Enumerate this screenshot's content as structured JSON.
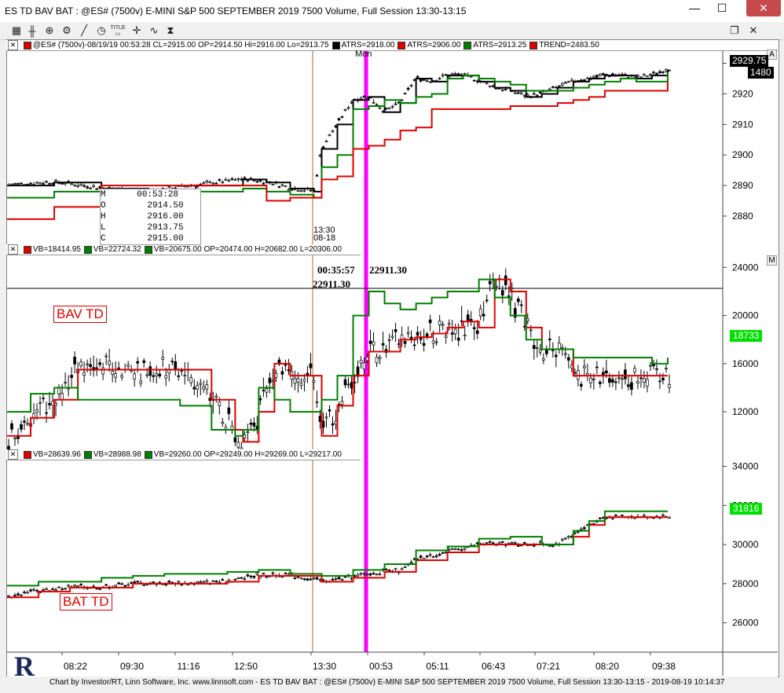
{
  "window": {
    "title": "ES TD BAV BAT : @ES# (7500v) E-MINI S&P 500 SEPTEMBER 2019 7500 Volume, Full Session 13:30-13:15",
    "close_label": "✕"
  },
  "toolbar": {
    "icons": [
      "chart-icon",
      "bar-style-icon",
      "zoom-icon",
      "settings-icon",
      "draw-line-icon",
      "clock-icon",
      "title-icon",
      "crosshair-icon",
      "cycle-icon",
      "hourglass-icon"
    ],
    "title_label": "TITLE"
  },
  "panel_top": {
    "header": "@ES# (7500v)-08/19/19 00:53:28 CL=2915.00 OP=2914.50 Hi=2916.00 Lo=2913.75",
    "legend": [
      {
        "label": "ATRS=2918.00",
        "color": "#000000"
      },
      {
        "label": "ATRS=2906.00",
        "color": "#e00000"
      },
      {
        "label": "ATRS=2913.25",
        "color": "#008000"
      },
      {
        "label": "TREND=2483.50",
        "color": "#e00000"
      }
    ],
    "day_label": "Mon",
    "session_time": "13:30",
    "session_date": "08-18",
    "price_badge": "2929.75",
    "volume_badge": "1480",
    "corner_label": "A",
    "ohlc": {
      "time": [
        "M",
        "00:53:28"
      ],
      "open": [
        "O",
        "2914.50"
      ],
      "high": [
        "H",
        "2916.00"
      ],
      "low": [
        "L",
        "2913.75"
      ],
      "close": [
        "C",
        "2915.00"
      ]
    }
  },
  "panel_mid": {
    "header_legend": [
      {
        "label": "VB=18414.95",
        "color": "#e00000"
      },
      {
        "label": "VB=22724.32",
        "color": "#008000"
      },
      {
        "label": "VB=20675.00 OP=20474.00 H=20682.00 L=20306.00",
        "color": "#008000"
      }
    ],
    "study_label": "BAV TD",
    "crosshair_time": "00:35:57",
    "crosshair_value": "22911.30",
    "crosshair_value_left": "22911.30",
    "value_badge": "18733",
    "corner_label": "M"
  },
  "panel_bot": {
    "header_legend": [
      {
        "label": "VB=28639.96",
        "color": "#e00000"
      },
      {
        "label": "VB=28988.98",
        "color": "#008000"
      },
      {
        "label": "VB=29260.00 OP=29249.00 H=29269.00 L=29217.00",
        "color": "#008000"
      }
    ],
    "study_label": "BAT TD",
    "value_badge": "31816"
  },
  "footer": {
    "text": "Chart by Investor/RT, Linn Software, Inc. www.linnsoft.com - ES TD BAV BAT : @ES# (7500v) E-MINI S&P 500 SEPTEMBER 2019 7500 Volume, Full Session 13:30-13:15 - 2019-08-19 10:14:37",
    "logo_letter": "R"
  },
  "colors": {
    "red": "#e00000",
    "green": "#008000",
    "magenta": "#ff00ff",
    "session_line": "#c06030",
    "badge_green": "#00e000"
  },
  "chart_data": [
    {
      "type": "line",
      "name": "price",
      "ylim": [
        2871,
        2934
      ],
      "yticks": [
        "2930",
        "2920",
        "2910",
        "2900",
        "2890",
        "2880"
      ],
      "series": [
        {
          "name": "ATRS=2918.00",
          "color": "#000000",
          "x": [
            0,
            60,
            120,
            180,
            240,
            300,
            330,
            360,
            390,
            400,
            420,
            440,
            460,
            480,
            500,
            520,
            540,
            560,
            580,
            600,
            620,
            640,
            660,
            680,
            700,
            720,
            740,
            760,
            780,
            800,
            820,
            840
          ],
          "values": [
            2890,
            2891,
            2889,
            2888,
            2890,
            2892,
            2891,
            2889,
            2888,
            2902,
            2910,
            2918,
            2919,
            2914,
            2917,
            2925,
            2924,
            2926,
            2926,
            2924,
            2922,
            2921,
            2919,
            2920,
            2922,
            2924,
            2925,
            2926,
            2926,
            2925,
            2926,
            2928
          ]
        },
        {
          "name": "ATRS=2913.25",
          "color": "#008000",
          "x": [
            0,
            60,
            120,
            180,
            240,
            300,
            330,
            360,
            390,
            400,
            420,
            440,
            460,
            480,
            500,
            520,
            540,
            560,
            580,
            600,
            620,
            640,
            660,
            680,
            700,
            720,
            740,
            760,
            780,
            800,
            820,
            840
          ],
          "values": [
            2886,
            2888,
            2887,
            2886,
            2888,
            2889,
            2888,
            2887,
            2886,
            2896,
            2900,
            2915,
            2916,
            2918,
            2917,
            2919,
            2920,
            2925,
            2926,
            2925,
            2924,
            2923,
            2921,
            2921,
            2921,
            2922,
            2923,
            2924,
            2925,
            2924,
            2924,
            2927
          ]
        },
        {
          "name": "ATRS=2906.00",
          "color": "#e00000",
          "x": [
            0,
            60,
            120,
            180,
            240,
            300,
            330,
            360,
            390,
            400,
            420,
            440,
            460,
            480,
            500,
            520,
            540,
            560,
            580,
            600,
            620,
            640,
            660,
            680,
            700,
            720,
            740,
            760,
            780,
            800,
            820,
            840
          ],
          "values": [
            2879,
            2883,
            2890,
            2890,
            2890,
            2890,
            2885,
            2886,
            2886,
            2892,
            2893,
            2902,
            2903,
            2905,
            2908,
            2909,
            2915,
            2915,
            2915,
            2915,
            2915,
            2916,
            2916,
            2916,
            2917,
            2918,
            2919,
            2921,
            2921,
            2921,
            2921,
            2924
          ]
        }
      ]
    },
    {
      "type": "line",
      "name": "BAV TD",
      "ylim": [
        9000,
        25000
      ],
      "yticks": [
        "24000",
        "20000",
        "16000",
        "12000"
      ],
      "series": [
        {
          "name": "VB=18414.95",
          "color": "#e00000",
          "x": [
            0,
            30,
            60,
            90,
            120,
            180,
            220,
            260,
            290,
            300,
            320,
            340,
            360,
            390,
            400,
            420,
            440,
            460,
            480,
            500,
            520,
            540,
            560,
            580,
            600,
            620,
            640,
            660,
            680,
            700,
            720,
            740,
            760,
            780,
            800,
            820,
            840
          ],
          "values": [
            10000,
            11500,
            13000,
            15500,
            15500,
            15500,
            15500,
            13000,
            10500,
            9500,
            12000,
            16000,
            15000,
            15000,
            10000,
            12500,
            15000,
            17000,
            17000,
            18000,
            18200,
            18500,
            19000,
            19500,
            19000,
            23000,
            22000,
            19000,
            17200,
            17200,
            15000,
            15000,
            15000,
            15000,
            15000,
            15000,
            15000
          ]
        },
        {
          "name": "VB=22724.32",
          "color": "#008000",
          "x": [
            0,
            30,
            60,
            90,
            120,
            180,
            220,
            260,
            290,
            300,
            320,
            340,
            360,
            390,
            400,
            420,
            440,
            460,
            480,
            500,
            520,
            540,
            560,
            580,
            600,
            620,
            640,
            660,
            680,
            700,
            720,
            740,
            760,
            780,
            800,
            820,
            840
          ],
          "values": [
            12000,
            13500,
            14000,
            13000,
            13000,
            13000,
            12500,
            10500,
            10000,
            10500,
            14000,
            13000,
            12000,
            12000,
            13000,
            15000,
            20000,
            22000,
            21000,
            20500,
            21000,
            21500,
            22000,
            22000,
            23000,
            21500,
            20000,
            18000,
            17200,
            17200,
            16500,
            16500,
            16500,
            16500,
            16500,
            16000,
            16500
          ]
        }
      ]
    },
    {
      "type": "line",
      "name": "BAT TD",
      "ylim": [
        24500,
        34300
      ],
      "yticks": [
        "34000",
        "32000",
        "30000",
        "28000",
        "26000"
      ],
      "series": [
        {
          "name": "VB=28639.96",
          "color": "#e00000",
          "x": [
            0,
            40,
            80,
            120,
            160,
            200,
            240,
            280,
            320,
            360,
            400,
            440,
            480,
            500,
            520,
            560,
            600,
            640,
            680,
            700,
            720,
            740,
            760,
            800,
            840
          ],
          "values": [
            27300,
            27600,
            27800,
            27800,
            28000,
            28000,
            28000,
            28100,
            28400,
            28400,
            28100,
            28300,
            28600,
            28600,
            29200,
            29600,
            30000,
            30000,
            30000,
            30000,
            30400,
            31000,
            31400,
            31400,
            31400
          ]
        },
        {
          "name": "VB=28988.98",
          "color": "#008000",
          "x": [
            0,
            40,
            80,
            120,
            160,
            200,
            240,
            280,
            320,
            360,
            400,
            440,
            480,
            500,
            520,
            560,
            600,
            640,
            680,
            700,
            720,
            740,
            760,
            800,
            840
          ],
          "values": [
            27900,
            28100,
            28100,
            28300,
            28400,
            28500,
            28500,
            28600,
            28700,
            28500,
            28400,
            28700,
            29000,
            29000,
            29700,
            29900,
            30300,
            30400,
            30000,
            30000,
            30700,
            31200,
            31700,
            31700,
            31700
          ]
        }
      ]
    }
  ],
  "time_axis": [
    "08:22",
    "09:30",
    "11:16",
    "12:50",
    "13:30",
    "00:53",
    "05:11",
    "06:43",
    "07:21",
    "08:20",
    "09:38"
  ]
}
